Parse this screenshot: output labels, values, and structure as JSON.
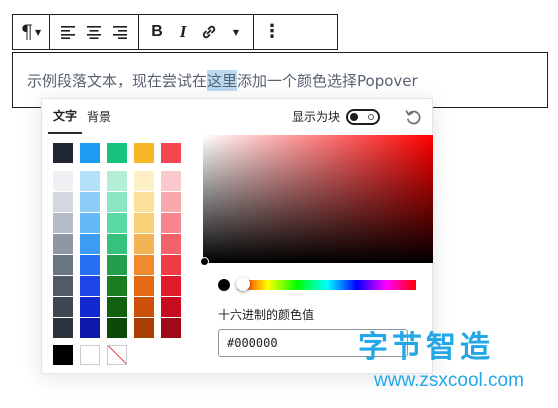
{
  "toolbar": {
    "paragraph_glyph": "¶",
    "bold_label": "B",
    "italic_label": "I",
    "more_glyph": "⋮",
    "icons": [
      "pilcrow-icon",
      "align-left-icon",
      "align-center-icon",
      "align-right-icon",
      "bold-icon",
      "italic-icon",
      "link-icon",
      "chevron-down-icon",
      "more-vertical-icon"
    ]
  },
  "paragraph": {
    "before": "示例段落文本，现在尝试在",
    "highlighted": "这里",
    "after": "添加一个颜色选择Popover"
  },
  "popover": {
    "tabs": [
      {
        "label": "文字",
        "active": true
      },
      {
        "label": "背景",
        "active": false
      }
    ],
    "show_as_block_label": "显示为块",
    "show_as_block_on": false,
    "palette": {
      "top_row": [
        "#222833",
        "#1e9bf0",
        "#19c37d",
        "#f7b728",
        "#f2474f"
      ],
      "shades": [
        [
          "#eef0f4",
          "#b5e0fb",
          "#b3efd6",
          "#fdf0c4",
          "#fbc9cc"
        ],
        [
          "#d3d7de",
          "#8ccdf8",
          "#8ae6c0",
          "#fbe29c",
          "#f9a8ae"
        ],
        [
          "#b6bcc6",
          "#63b8f6",
          "#5ad8a3",
          "#f8d07a",
          "#f6858d"
        ],
        [
          "#8f97a4",
          "#3e9bf4",
          "#35c27d",
          "#f4b354",
          "#f3626b"
        ],
        [
          "#6b7482",
          "#2870f3",
          "#239f4b",
          "#ef8b2c",
          "#ef3b46"
        ],
        [
          "#525a67",
          "#1d45e6",
          "#1a7d20",
          "#e66a12",
          "#e0192b"
        ],
        [
          "#3f4652",
          "#1428cf",
          "#116010",
          "#cc5009",
          "#c60d1f"
        ],
        [
          "#2d333d",
          "#0d17a8",
          "#0b4a08",
          "#a83d06",
          "#9e0a18"
        ]
      ],
      "bottom_row": [
        "#000000",
        "#ffffff",
        "none"
      ]
    },
    "picker": {
      "hue_color": "#ff0000",
      "current_color": "#000000",
      "hex_label": "十六进制的颜色值",
      "hex_value": "#000000"
    }
  },
  "watermark": {
    "title": "字节智造",
    "url": "www.zsxcool.com"
  }
}
